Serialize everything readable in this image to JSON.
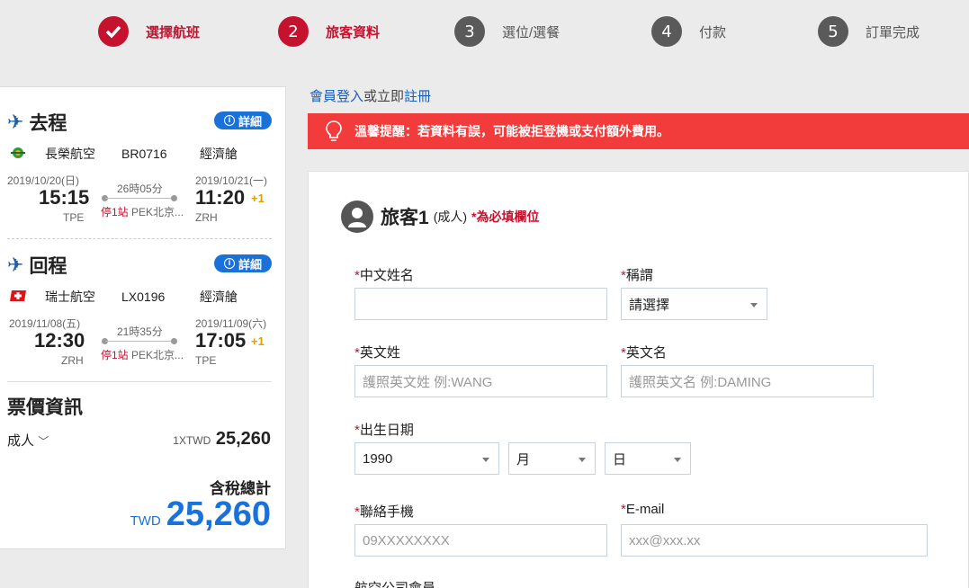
{
  "steps": [
    {
      "num": "",
      "label": "選擇航班",
      "state": "done"
    },
    {
      "num": "2",
      "label": "旅客資料",
      "state": "active"
    },
    {
      "num": "3",
      "label": "選位/選餐",
      "state": "todo"
    },
    {
      "num": "4",
      "label": "付款",
      "state": "todo"
    },
    {
      "num": "5",
      "label": "訂單完成",
      "state": "todo"
    }
  ],
  "outbound": {
    "title": "去程",
    "detail": "詳細",
    "airline": "長榮航空",
    "flight": "BR0716",
    "cabin": "經濟艙",
    "dep_date": "2019/10/20(日)",
    "dep_time": "15:15",
    "dep_code": "TPE",
    "duration": "26時05分",
    "stop_label": "停1站",
    "stop_city": "PEK北京...",
    "arr_date": "2019/10/21(一)",
    "arr_time": "11:20",
    "arr_plus": "+1",
    "arr_code": "ZRH"
  },
  "inbound": {
    "title": "回程",
    "detail": "詳細",
    "airline": "瑞士航空",
    "flight": "LX0196",
    "cabin": "經濟艙",
    "dep_date": "2019/11/08(五)",
    "dep_time": "12:30",
    "dep_code": "ZRH",
    "duration": "21時35分",
    "stop_label": "停1站",
    "stop_city": "PEK北京...",
    "arr_date": "2019/11/09(六)",
    "arr_time": "17:05",
    "arr_plus": "+1",
    "arr_code": "TPE"
  },
  "fare": {
    "title": "票價資訊",
    "pax_type": "成人",
    "pax_currency": "1XTWD",
    "pax_amount": "25,260",
    "total_label": "含稅總計",
    "total_currency": "TWD",
    "total_amount": "25,260"
  },
  "login": {
    "member_login": "會員登入",
    "or_text": "或立即",
    "register": "註冊"
  },
  "warning": "溫馨提醒：若資料有誤，可能被拒登機或支付額外費用。",
  "passenger": {
    "title": "旅客1",
    "type": "(成人)",
    "required_note": "*為必填欄位"
  },
  "form": {
    "req_mark": "*",
    "chinese_name_label": "中文姓名",
    "chinese_name_value": "",
    "title_label": "稱謂",
    "title_value": "請選擇",
    "surname_label": "英文姓",
    "surname_placeholder": "護照英文姓 例:WANG",
    "given_label": "英文名",
    "given_placeholder": "護照英文名 例:DAMING",
    "dob_label": "出生日期",
    "dob_year": "1990",
    "dob_month": "月",
    "dob_day": "日",
    "mobile_label": "聯絡手機",
    "mobile_placeholder": "09XXXXXXXX",
    "email_label": "E-mail",
    "email_placeholder": "xxx@xxx.xx",
    "airline_member_label": "航空公司會員"
  },
  "colors": {
    "brand_red": "#c4122f",
    "accent_blue": "#1a72d9",
    "warning_bg": "#f23b3b"
  }
}
